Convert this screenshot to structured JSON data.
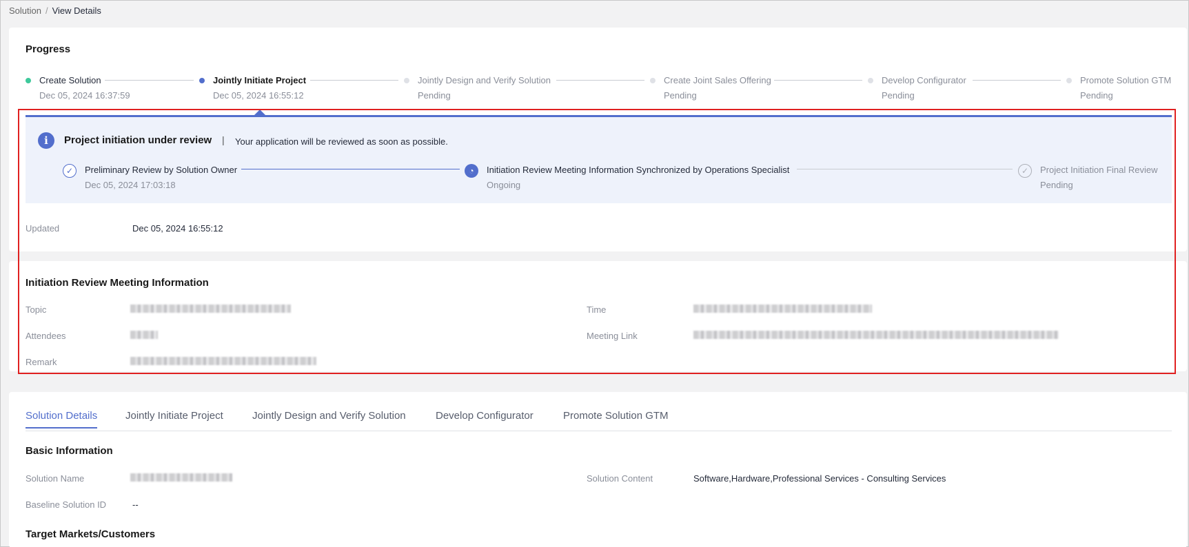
{
  "breadcrumb": {
    "root": "Solution",
    "separator": "/",
    "current": "View Details"
  },
  "progress": {
    "title": "Progress",
    "steps": [
      {
        "name": "Create Solution",
        "status": "Dec 05, 2024 16:37:59"
      },
      {
        "name": "Jointly Initiate Project",
        "status": "Dec 05, 2024 16:55:12"
      },
      {
        "name": "Jointly Design and Verify Solution",
        "status": "Pending"
      },
      {
        "name": "Create Joint Sales Offering",
        "status": "Pending"
      },
      {
        "name": "Develop Configurator",
        "status": "Pending"
      },
      {
        "name": "Promote Solution GTM",
        "status": "Pending"
      }
    ],
    "colors": {
      "done": "#3ec99b",
      "active": "#526ecc",
      "pending": "#dfe1e6"
    }
  },
  "review": {
    "title": "Project initiation under review",
    "divider": "|",
    "message": "Your application will be reviewed as soon as possible.",
    "steps": [
      {
        "name": "Preliminary Review by Solution Owner",
        "status": "Dec 05, 2024 17:03:18",
        "icon": "✓"
      },
      {
        "name": "Initiation Review Meeting Information Synchronized by Operations Specialist",
        "status": "Ongoing",
        "icon": "◔"
      },
      {
        "name": "Project Initiation Final Review",
        "status": "Pending",
        "icon": "✓"
      }
    ],
    "info_icon": "i"
  },
  "updated": {
    "label": "Updated",
    "value": "Dec 05, 2024 16:55:12"
  },
  "meeting": {
    "title": "Initiation Review Meeting Information",
    "labels": {
      "topic": "Topic",
      "attendees": "Attendees",
      "remark": "Remark",
      "time": "Time",
      "meeting_link": "Meeting Link"
    }
  },
  "tabs": [
    "Solution Details",
    "Jointly Initiate Project",
    "Jointly Design and Verify Solution",
    "Develop Configurator",
    "Promote Solution GTM"
  ],
  "basic_info": {
    "title": "Basic Information",
    "solution_name_label": "Solution Name",
    "baseline_id_label": "Baseline Solution ID",
    "baseline_id_value": "--",
    "solution_content_label": "Solution Content",
    "solution_content_value": "Software,Hardware,Professional Services - Consulting Services"
  },
  "target_markets": {
    "title": "Target Markets/Customers"
  }
}
